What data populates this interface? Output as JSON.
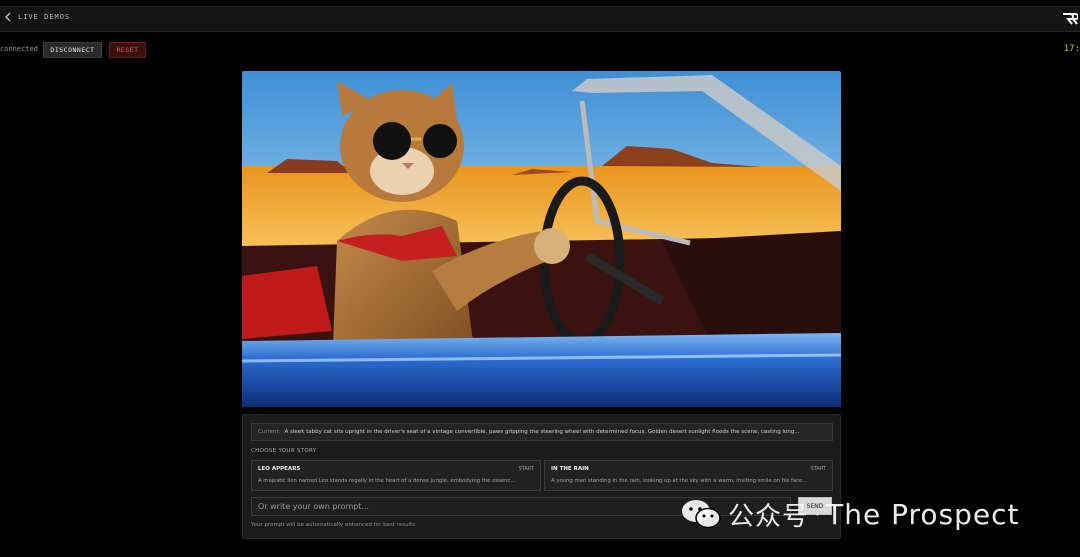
{
  "nav": {
    "back_label": "LIVE DEMOS"
  },
  "status": {
    "connection_text": "connected",
    "disconnect_label": "DISCONNECT",
    "reset_label": "RESET",
    "clock": "17:"
  },
  "scene": {
    "subject": "cat driving a vintage convertible in the desert"
  },
  "story": {
    "current_label": "Current:",
    "current_text": "A sleek tabby cat sits upright in the driver's seat of a vintage convertible, paws gripping the steering wheel with determined focus. Golden desert sunlight floods the scene, casting long...",
    "choose_label": "CHOOSE YOUR STORY",
    "cards": [
      {
        "title": "LEO APPEARS",
        "action": "START",
        "desc": "A majestic lion named Leo stands regally in the heart of a dense jungle, embodying the essenc..."
      },
      {
        "title": "IN THE RAIN",
        "action": "START",
        "desc": "A young man standing in the rain, looking up at the sky with a warm, inviting smile on his face..."
      }
    ],
    "prompt_placeholder": "Or write your own prompt...",
    "send_label": "SEND",
    "hint": "Your prompt will be automatically enhanced for best results."
  },
  "watermark": {
    "platform": "公众号",
    "separator": "·",
    "brand": "The Prospect"
  },
  "colors": {
    "background": "#000000",
    "reset": "#ef5350",
    "clock": "#d9b84a",
    "car_blue": "#1f5bbf",
    "desert": "#f0a52a"
  }
}
